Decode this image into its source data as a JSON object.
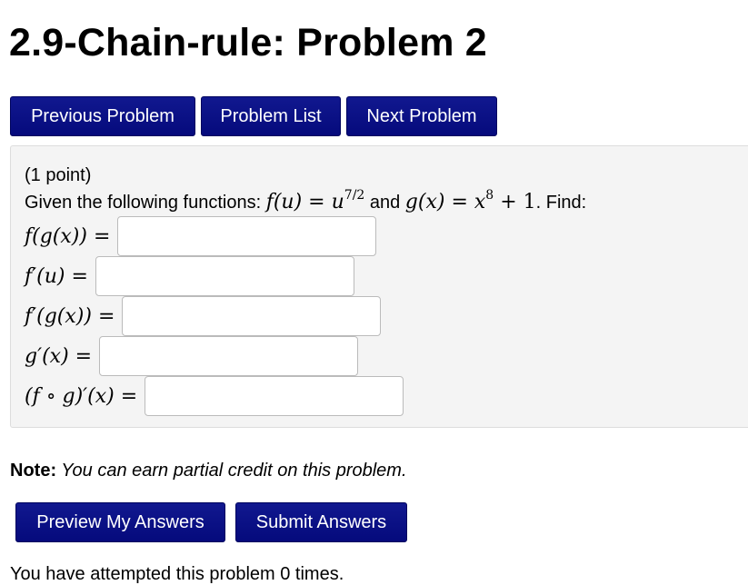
{
  "page": {
    "title": "2.9-Chain-rule: Problem 2"
  },
  "nav": {
    "previous_label": "Previous Problem",
    "list_label": "Problem List",
    "next_label": "Next Problem"
  },
  "problem": {
    "points": "(1 point)",
    "given_prefix": "Given the following functions: ",
    "f_def": "f(u) = u",
    "f_exp": "7/2",
    "and_text": " and ",
    "g_def": "g(x) = x",
    "g_exp": "8",
    "g_tail": " + 1",
    "find_text": ". Find:",
    "answers": [
      {
        "label": "f(g(x)) =",
        "value": ""
      },
      {
        "label": "f′(u) =",
        "value": ""
      },
      {
        "label": "f′(g(x)) =",
        "value": ""
      },
      {
        "label": "g′(x) =",
        "value": ""
      },
      {
        "label": "(f ∘ g)′(x) =",
        "value": ""
      }
    ]
  },
  "note": {
    "label": "Note:",
    "text": " You can earn partial credit on this problem."
  },
  "submit": {
    "preview_label": "Preview My Answers",
    "submit_label": "Submit Answers"
  },
  "status": {
    "attempts": "You have attempted this problem 0 times."
  }
}
